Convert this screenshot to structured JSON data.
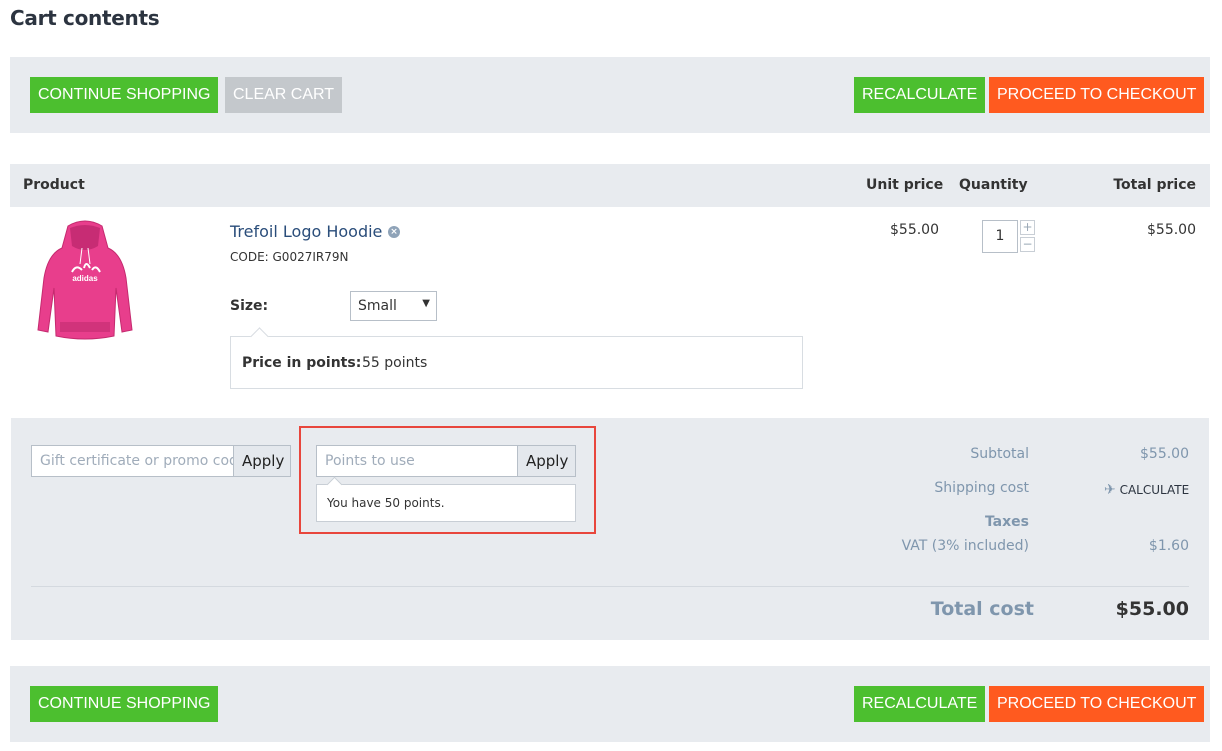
{
  "page": {
    "title": "Cart contents"
  },
  "toolbar_top": {
    "continue_label": "CONTINUE SHOPPING",
    "clear_label": "CLEAR CART",
    "recalculate_label": "RECALCULATE",
    "checkout_label": "PROCEED TO CHECKOUT"
  },
  "table": {
    "headers": {
      "product": "Product",
      "unit_price": "Unit price",
      "quantity": "Quantity",
      "total_price": "Total price"
    }
  },
  "item": {
    "name": "Trefoil Logo Hoodie",
    "code": "CODE: G0027IR79N",
    "size_label": "Size:",
    "size_value": "Small",
    "points_label": "Price in points:",
    "points_value": "55 points",
    "unit_price": "$55.00",
    "quantity": "1",
    "total_price": "$55.00",
    "image_icon": "pink-hoodie",
    "image_text": "adidas"
  },
  "promo": {
    "placeholder": "Gift certificate or promo code",
    "apply_label": "Apply"
  },
  "points": {
    "placeholder": "Points to use",
    "apply_label": "Apply",
    "info": "You have 50 points."
  },
  "summary": {
    "subtotal_label": "Subtotal",
    "subtotal_value": "$55.00",
    "shipping_label": "Shipping cost",
    "shipping_action": "CALCULATE",
    "taxes_label": "Taxes",
    "vat_label": "VAT (3% included)",
    "vat_value": "$1.60",
    "total_label": "Total cost",
    "total_value": "$55.00"
  },
  "toolbar_bottom": {
    "continue_label": "CONTINUE SHOPPING",
    "recalculate_label": "RECALCULATE",
    "checkout_label": "PROCEED TO CHECKOUT"
  },
  "colors": {
    "green": "#4cbf2f",
    "orange": "#ff5a1f",
    "grey": "#c4c8cc",
    "highlight": "#e8463c",
    "panel": "#e8ebef"
  }
}
